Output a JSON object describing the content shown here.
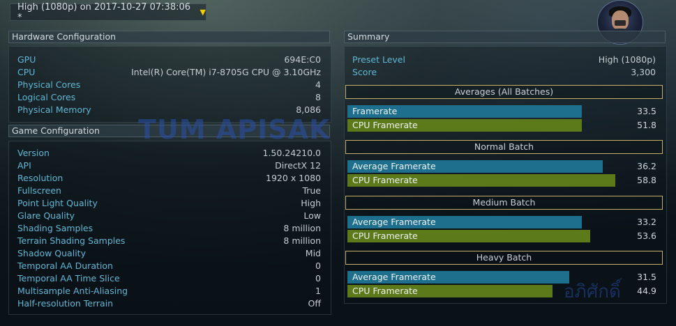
{
  "run_selector": {
    "label": "High (1080p) on 2017-10-27 07:38:06 *",
    "arrow": "▼"
  },
  "watermark": {
    "text": "TUM APISAK",
    "thai": "อภิศักดิ์"
  },
  "hardware": {
    "title": "Hardware Configuration",
    "rows": [
      {
        "k": "GPU",
        "v": "694E:C0"
      },
      {
        "k": "CPU",
        "v": "Intel(R) Core(TM) i7-8705G CPU @ 3.10GHz"
      },
      {
        "k": "Physical Cores",
        "v": "4"
      },
      {
        "k": "Logical Cores",
        "v": "8"
      },
      {
        "k": "Physical Memory",
        "v": "8,086"
      }
    ]
  },
  "game": {
    "title": "Game Configuration",
    "rows": [
      {
        "k": "Version",
        "v": "1.50.24210.0"
      },
      {
        "k": "API",
        "v": "DirectX 12"
      },
      {
        "k": "Resolution",
        "v": "1920 x 1080"
      },
      {
        "k": "Fullscreen",
        "v": "True"
      },
      {
        "k": "Point Light Quality",
        "v": "High"
      },
      {
        "k": "Glare Quality",
        "v": "Low"
      },
      {
        "k": "Shading Samples",
        "v": "8 million"
      },
      {
        "k": "Terrain Shading Samples",
        "v": "8 million"
      },
      {
        "k": "Shadow Quality",
        "v": "Mid"
      },
      {
        "k": "Temporal AA Duration",
        "v": "0"
      },
      {
        "k": "Temporal AA Time Slice",
        "v": "0"
      },
      {
        "k": "Multisample Anti-Aliasing",
        "v": "1"
      },
      {
        "k": "Half-resolution Terrain",
        "v": "Off"
      }
    ]
  },
  "summary": {
    "title": "Summary",
    "preset_label": "Preset Level",
    "preset_value": "High (1080p)",
    "score_label": "Score",
    "score_value": "3,300",
    "sections": [
      {
        "title": "Averages (All Batches)",
        "bars": [
          {
            "label": "Framerate",
            "value": "33.5",
            "color": "#1e6f8e",
            "fraction": 0.56
          },
          {
            "label": "CPU Framerate",
            "value": "51.8",
            "color": "#5c7a1a",
            "fraction": 0.56
          }
        ]
      },
      {
        "title": "Normal Batch",
        "bars": [
          {
            "label": "Average Framerate",
            "value": "36.2",
            "color": "#1e6f8e",
            "fraction": 0.61
          },
          {
            "label": "CPU Framerate",
            "value": "58.8",
            "color": "#5c7a1a",
            "fraction": 0.64
          }
        ]
      },
      {
        "title": "Medium Batch",
        "bars": [
          {
            "label": "Average Framerate",
            "value": "33.2",
            "color": "#1e6f8e",
            "fraction": 0.56
          },
          {
            "label": "CPU Framerate",
            "value": "53.6",
            "color": "#5c7a1a",
            "fraction": 0.58
          }
        ]
      },
      {
        "title": "Heavy Batch",
        "bars": [
          {
            "label": "Average Framerate",
            "value": "31.5",
            "color": "#1e6f8e",
            "fraction": 0.53
          },
          {
            "label": "CPU Framerate",
            "value": "44.9",
            "color": "#5c7a1a",
            "fraction": 0.49
          }
        ]
      }
    ]
  }
}
